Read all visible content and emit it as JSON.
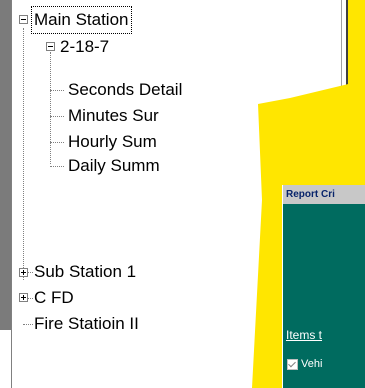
{
  "tree": {
    "nodes": [
      {
        "label": "Main Station",
        "expander": "minus"
      },
      {
        "label": "2-18-7",
        "expander": "minus"
      },
      {
        "label": "Seconds Detail",
        "expander": "none"
      },
      {
        "label": "Minutes Sur",
        "expander": "none"
      },
      {
        "label": "Hourly Sum",
        "expander": "none"
      },
      {
        "label": "Daily Summ",
        "expander": "none"
      },
      {
        "label": "Sub Station 1",
        "expander": "plus"
      },
      {
        "label": "C FD",
        "expander": "plus"
      },
      {
        "label": "Fire Statioin II",
        "expander": "none"
      }
    ]
  },
  "dialog": {
    "title": "Report Cri",
    "items_link": "Items t",
    "check_label": "Vehi",
    "checked": true
  },
  "colors": {
    "highlight_yellow": "#ffe600",
    "dialog_teal": "#006b5f",
    "dialog_title_bar": "#c8c8c8",
    "dialog_title_text": "#08246b"
  }
}
